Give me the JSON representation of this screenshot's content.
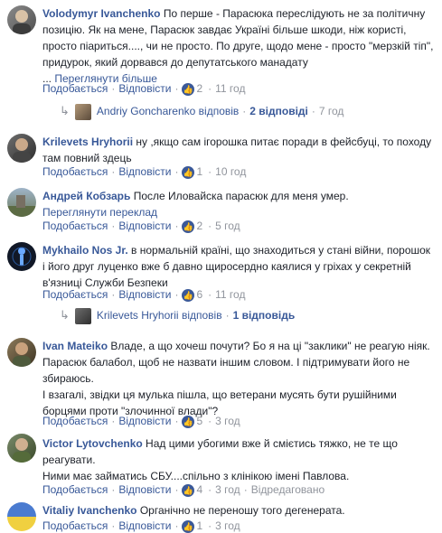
{
  "labels": {
    "like": "Подобається",
    "reply": "Відповісти",
    "sep": "·"
  },
  "comments": [
    {
      "author": "Volodymyr Ivanchenko",
      "text": "По перше - Парасюка переслідують не за політичну позицію. Як на мене, Парасюк завдає Україні більше шкоди, ніж користі, просто піариться...., чи не просто. По друге, щодо мене - просто \"мерзкій тіп\", придурок, який дорвався до депутатського манадату",
      "see_more_prefix": "...",
      "see_more": "Переглянути більше",
      "reactions": "2",
      "time": "11 год",
      "reply_author": "Andriy Goncharenko",
      "replied": "відповів",
      "reply_count": "2 відповіді",
      "reply_time": "7 год"
    },
    {
      "author": "Krilevets Hryhorii",
      "text": "ну ,якщо сам ігорошка питає поради в фейсбуці, то походу там повний здець",
      "reactions": "1",
      "time": "10 год"
    },
    {
      "author": "Андрей Кобзарь",
      "text": "После Иловайска парасюк для меня умер.",
      "see_translation": "Переглянути переклад",
      "reactions": "2",
      "time": "5 год"
    },
    {
      "author": "Mykhailo Nos Jr.",
      "text": "в нормальній країні, що знаходиться у стані війни, порошок і його друг луценко вже б давно щиросердно каялися у гріхах у секретній в'язниці Служби Безпеки",
      "reactions": "6",
      "time": "11 год",
      "reply_author": "Krilevets Hryhorii",
      "replied": "відповів",
      "reply_count": "1 відповідь"
    },
    {
      "author": "Ivan Mateiko",
      "text": "Владе, а що хочеш почути? Бо я на ці \"заклики\" не реагую ніяк. Парасюк балабол, щоб не назвати іншим словом. І підтримувати його не збираюсь.\nІ взагалі, звідки ця мулька пішла, що ветерани мусять бути рушійними борцями проти \"злочинної влади\"?",
      "reactions": "5",
      "time": "3 год"
    },
    {
      "author": "Victor Lytovchenko",
      "text": "Над цими убогими вже й смієтись тяжко, не те що реагувати.\nНими має займатись СБУ....спільно з клінікою імені Павлова.",
      "reactions": "4",
      "time": "3 год",
      "edited": "Відредаговано"
    },
    {
      "author": "Vitaliy Ivanchenko",
      "text": "Органічно не переношу того дегенерата.",
      "reactions": "1",
      "time": "3 год"
    }
  ],
  "colors": {
    "link": "#385898",
    "meta": "#90949c",
    "text": "#1d2129",
    "like_badge": "#3b5998"
  },
  "icons": {
    "like": "thumbs-up-icon",
    "reply_arrow": "reply-arrow-icon"
  }
}
